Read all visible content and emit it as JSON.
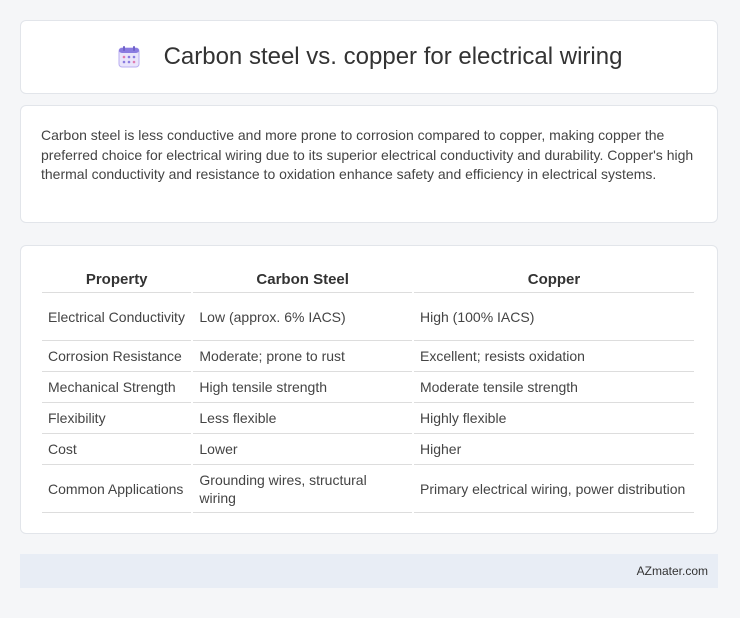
{
  "header": {
    "icon": "calendar-icon",
    "title": "Carbon steel vs. copper for electrical wiring"
  },
  "summary": {
    "text": "Carbon steel is less conductive and more prone to corrosion compared to copper, making copper the preferred choice for electrical wiring due to its superior electrical conductivity and durability. Copper's high thermal conductivity and resistance to oxidation enhance safety and efficiency in electrical systems."
  },
  "table": {
    "headers": [
      "Property",
      "Carbon Steel",
      "Copper"
    ],
    "rows": [
      [
        "Electrical Conductivity",
        "Low (approx. 6% IACS)",
        "High (100% IACS)"
      ],
      [
        "Corrosion Resistance",
        "Moderate; prone to rust",
        "Excellent; resists oxidation"
      ],
      [
        "Mechanical Strength",
        "High tensile strength",
        "Moderate tensile strength"
      ],
      [
        "Flexibility",
        "Less flexible",
        "Highly flexible"
      ],
      [
        "Cost",
        "Lower",
        "Higher"
      ],
      [
        "Common Applications",
        "Grounding wires, structural wiring",
        "Primary electrical wiring, power distribution"
      ]
    ]
  },
  "footer": {
    "text": "AZmater.com"
  },
  "colors": {
    "background": "#f5f6f8",
    "card": "#ffffff",
    "footer": "#e8edf5",
    "icon_accent": "#8a7be0"
  }
}
